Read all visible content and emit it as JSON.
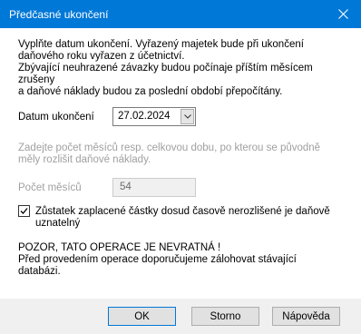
{
  "window": {
    "title": "Předčasné ukončení"
  },
  "intro": {
    "line1": "Vyplňte datum ukončení. Vyřazený majetek bude při ukončení",
    "line2": "daňového roku vyřazen z účetnictví.",
    "line3": "Zbývající neuhrazené závazky budou počínaje příštím měsícem zrušeny",
    "line4": "a daňové náklady budou za poslední období přepočítány."
  },
  "end_date": {
    "label": "Datum ukončení",
    "value": "27.02.2024"
  },
  "months": {
    "note_line1": "Zadejte počet měsíců resp. celkovou dobu, po kterou se původně",
    "note_line2": "měly rozlišit daňové náklady.",
    "label": "Počet měsíců",
    "value": "54"
  },
  "checkbox": {
    "checked": true,
    "line1": "Zůstatek zaplacené částky dosud časově nerozlišené je daňově",
    "line2": "uznatelný"
  },
  "warning": {
    "line1": "POZOR, TATO OPERACE JE NEVRATNÁ !",
    "line2": "Před provedením operace doporučujeme zálohovat stávající",
    "line3": "databázi."
  },
  "buttons": {
    "ok": "OK",
    "cancel": "Storno",
    "help": "Nápověda"
  },
  "colors": {
    "titlebar": "#0078d7",
    "focus_border": "#0078d7"
  }
}
